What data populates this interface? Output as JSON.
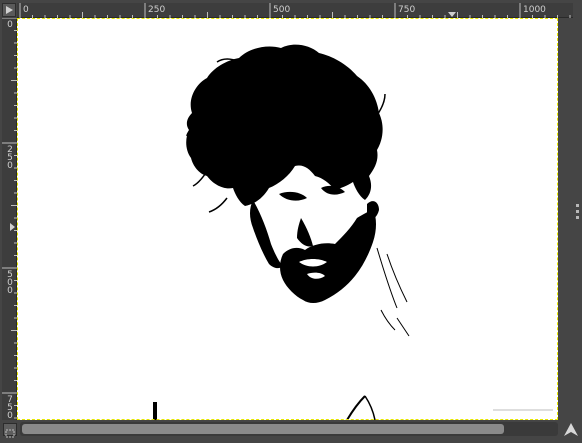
{
  "ruler": {
    "h_labels": [
      "0",
      "250",
      "500",
      "750",
      "1000"
    ],
    "v_labels": [
      "0",
      "250",
      "500",
      "750"
    ]
  },
  "canvas": {
    "image": "high-contrast black and white portrait of a man with tousled hair looking down",
    "selection_color": "#e6e600",
    "background": "#ffffff"
  },
  "icons": {
    "corner": "menu-arrow-icon",
    "quick_mask": "quick-mask-icon",
    "navigate": "navigate-icon"
  },
  "colors": {
    "chrome": "#454545",
    "ruler": "#3d3d3d",
    "thumb": "#8a8a8a"
  }
}
